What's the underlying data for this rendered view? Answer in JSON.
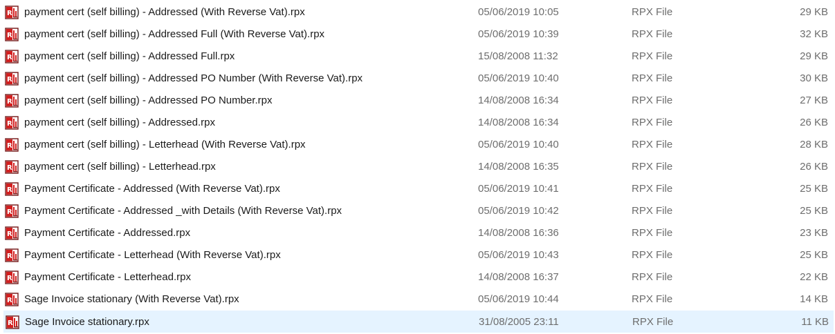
{
  "files": [
    {
      "name": "payment cert (self billing) - Addressed (With Reverse Vat).rpx",
      "date": "05/06/2019 10:05",
      "type": "RPX File",
      "size": "29 KB",
      "icon": "rpx-file-icon"
    },
    {
      "name": "payment cert (self billing) - Addressed Full (With Reverse Vat).rpx",
      "date": "05/06/2019 10:39",
      "type": "RPX File",
      "size": "32 KB",
      "icon": "rpx-file-icon"
    },
    {
      "name": "payment cert (self billing) - Addressed Full.rpx",
      "date": "15/08/2008 11:32",
      "type": "RPX File",
      "size": "29 KB",
      "icon": "rpx-file-icon"
    },
    {
      "name": "payment cert (self billing) - Addressed PO Number (With Reverse Vat).rpx",
      "date": "05/06/2019 10:40",
      "type": "RPX File",
      "size": "30 KB",
      "icon": "rpx-file-icon"
    },
    {
      "name": "payment cert (self billing) - Addressed PO Number.rpx",
      "date": "14/08/2008 16:34",
      "type": "RPX File",
      "size": "27 KB",
      "icon": "rpx-file-icon"
    },
    {
      "name": "payment cert (self billing) - Addressed.rpx",
      "date": "14/08/2008 16:34",
      "type": "RPX File",
      "size": "26 KB",
      "icon": "rpx-file-icon"
    },
    {
      "name": "payment cert (self billing) - Letterhead (With Reverse Vat).rpx",
      "date": "05/06/2019 10:40",
      "type": "RPX File",
      "size": "28 KB",
      "icon": "rpx-file-icon"
    },
    {
      "name": "payment cert (self billing) - Letterhead.rpx",
      "date": "14/08/2008 16:35",
      "type": "RPX File",
      "size": "26 KB",
      "icon": "rpx-file-icon"
    },
    {
      "name": "Payment Certificate - Addressed (With Reverse Vat).rpx",
      "date": "05/06/2019 10:41",
      "type": "RPX File",
      "size": "25 KB",
      "icon": "rpx-file-icon"
    },
    {
      "name": "Payment Certificate - Addressed _with Details (With Reverse Vat).rpx",
      "date": "05/06/2019 10:42",
      "type": "RPX File",
      "size": "25 KB",
      "icon": "rpx-file-icon"
    },
    {
      "name": "Payment Certificate - Addressed.rpx",
      "date": "14/08/2008 16:36",
      "type": "RPX File",
      "size": "23 KB",
      "icon": "rpx-file-icon"
    },
    {
      "name": "Payment Certificate - Letterhead (With Reverse Vat).rpx",
      "date": "05/06/2019 10:43",
      "type": "RPX File",
      "size": "25 KB",
      "icon": "rpx-file-icon"
    },
    {
      "name": "Payment Certificate - Letterhead.rpx",
      "date": "14/08/2008 16:37",
      "type": "RPX File",
      "size": "22 KB",
      "icon": "rpx-file-icon"
    },
    {
      "name": "Sage Invoice stationary (With Reverse Vat).rpx",
      "date": "05/06/2019 10:44",
      "type": "RPX File",
      "size": "14 KB",
      "icon": "rpx-file-icon"
    },
    {
      "name": "Sage Invoice stationary.rpx",
      "date": "31/08/2005 23:11",
      "type": "RPX File",
      "size": "11 KB",
      "icon": "rpx-file-icon",
      "selected": true
    }
  ],
  "colors": {
    "selection": "#e5f3ff",
    "icon_red": "#d21f1f",
    "icon_frame": "#7a2222",
    "meta_text": "#6d6d6d"
  }
}
